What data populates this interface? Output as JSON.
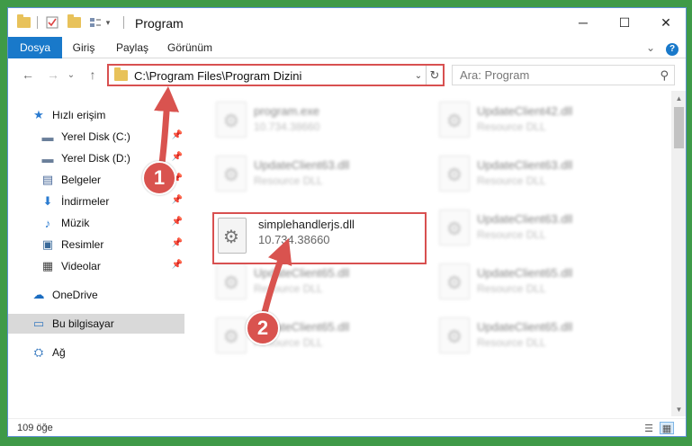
{
  "window": {
    "title": "Program",
    "controls": {
      "minimize": "─",
      "maximize": "☐",
      "close": "✕"
    }
  },
  "ribbon": {
    "tabs": [
      {
        "label": "Dosya",
        "active": true
      },
      {
        "label": "Giriş"
      },
      {
        "label": "Paylaş"
      },
      {
        "label": "Görünüm"
      }
    ],
    "expand": "⌄",
    "help": "?"
  },
  "nav": {
    "back": "←",
    "forward": "→",
    "recent": "⌄",
    "up": "↑",
    "address": "C:\\Program Files\\Program Dizini",
    "dropdown": "⌄",
    "refresh": "↻",
    "search_placeholder": "Ara: Program",
    "search_icon": "⚲"
  },
  "sidebar": {
    "items": [
      {
        "label": "Hızlı erişim",
        "icon": "star-icon",
        "glyph": "★"
      },
      {
        "label": "Yerel Disk (C:)",
        "icon": "drive-icon",
        "glyph": "▬",
        "pinned": true
      },
      {
        "label": "Yerel Disk (D:)",
        "icon": "drive-icon",
        "glyph": "▬",
        "pinned": true
      },
      {
        "label": "Belgeler",
        "icon": "documents-icon",
        "glyph": "▤",
        "pinned": true
      },
      {
        "label": "İndirmeler",
        "icon": "download-icon",
        "glyph": "⬇",
        "pinned": true
      },
      {
        "label": "Müzik",
        "icon": "music-icon",
        "glyph": "♪",
        "pinned": true
      },
      {
        "label": "Resimler",
        "icon": "pictures-icon",
        "glyph": "▣",
        "pinned": true
      },
      {
        "label": "Videolar",
        "icon": "video-icon",
        "glyph": "▦",
        "pinned": true
      },
      {
        "label": "OneDrive",
        "icon": "cloud-icon",
        "glyph": "☁"
      },
      {
        "label": "Bu bilgisayar",
        "icon": "computer-icon",
        "glyph": "▭",
        "selected": true
      },
      {
        "label": "Ağ",
        "icon": "network-icon",
        "glyph": "⛭"
      }
    ],
    "pin_glyph": "📌"
  },
  "files": {
    "items": [
      {
        "name": "program.exe",
        "desc": "10.734.38660"
      },
      {
        "name": "UpdateClient42.dll",
        "desc": "Resource DLL"
      },
      {
        "name": "UpdateClient63.dll",
        "desc": "Resource DLL"
      },
      {
        "name": "UpdateClient63.dll",
        "desc": "Resource DLL"
      },
      {
        "name": "UpdateClient63.dll",
        "desc": "Resource DLL"
      },
      {
        "name": "UpdateClient65.dll",
        "desc": "Resource DLL"
      },
      {
        "name": "UpdateClient65.dll",
        "desc": "Resource DLL"
      },
      {
        "name": "UpdateClient65.dll",
        "desc": "Resource DLL"
      },
      {
        "name": "UpdateClient65.dll",
        "desc": "Resource DLL"
      }
    ],
    "highlighted": {
      "name": "simplehandlerjs.dll",
      "desc": "10.734.38660"
    }
  },
  "status": {
    "count": "109 öğe",
    "details_view": "☰",
    "icons_view": "▦"
  },
  "callouts": [
    {
      "label": "1"
    },
    {
      "label": "2"
    }
  ],
  "colors": {
    "accent": "#1979ca",
    "highlight": "#d85050",
    "badge": "#d9534f"
  }
}
